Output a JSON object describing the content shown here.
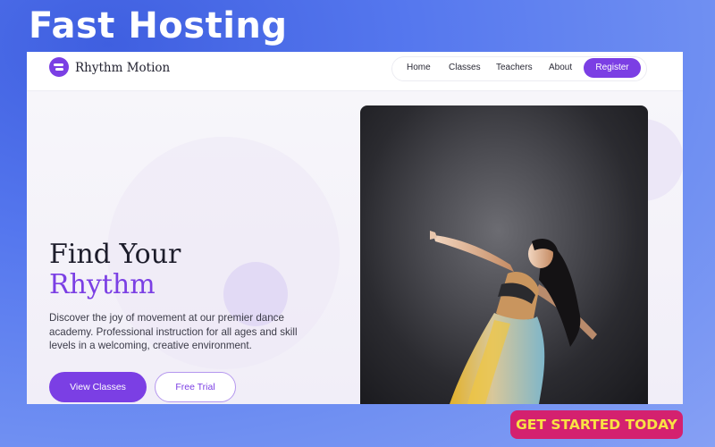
{
  "banner": {
    "title": "Fast Hosting"
  },
  "site": {
    "brand": {
      "name": "Rhythm Motion",
      "logo_icon": "logo-icon"
    },
    "nav": {
      "items": [
        "Home",
        "Classes",
        "Teachers",
        "About"
      ],
      "register_label": "Register"
    },
    "hero": {
      "title_line1": "Find Your",
      "title_line2": "Rhythm",
      "description": "Discover the joy of movement at our premier dance academy. Professional instruction for all ages and skill levels in a welcoming, creative environment.",
      "primary_button": "View Classes",
      "secondary_button": "Free Trial",
      "image_subject": "dancer-photo"
    }
  },
  "cta": {
    "label": "GET STARTED TODAY"
  },
  "colors": {
    "accent": "#7b3fe4",
    "cta_background": "#d4216f",
    "cta_text": "#f9e244",
    "page_background": "#5577ee"
  }
}
